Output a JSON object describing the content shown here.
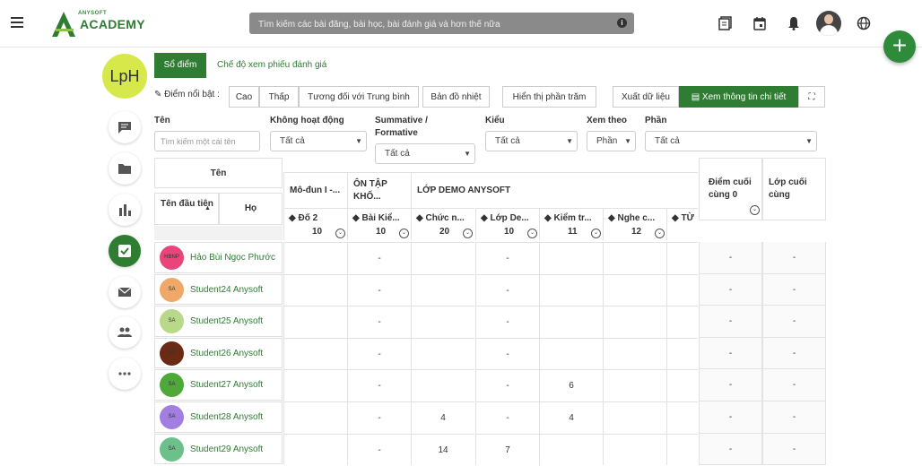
{
  "topbar": {
    "logo_small": "ANYSOFT",
    "logo_main": "ACADEMY",
    "search_placeholder": "Tìm kiếm các bài đăng, bài học, bài đánh giá và hơn thế nữa"
  },
  "course": {
    "avatar_text": "LpH"
  },
  "tabs": [
    {
      "label": "Sổ điểm",
      "active": true
    },
    {
      "label": "Chế độ xem phiếu đánh giá",
      "active": false
    }
  ],
  "toolbar": {
    "highlight_label": "Điểm nổi bật :",
    "highlight_buttons": [
      "Cao",
      "Thấp",
      "Tương đối với Trung bình"
    ],
    "heatmap": "Bản đồ nhiệt",
    "show_percent": "Hiển thị phần trăm",
    "export": "Xuất dữ liệu",
    "detail": "Xem thông tin chi tiết"
  },
  "filters": {
    "name_label": "Tên",
    "name_placeholder": "Tìm kiếm một cái tên",
    "inactive_label": "Không hoạt động",
    "inactive_value": "Tất cả",
    "summative_label": "Summative / Formative",
    "summative_value": "Tất cả",
    "type_label": "Kiểu",
    "type_value": "Tất cả",
    "viewby_label": "Xem theo",
    "viewby_value": "Phần",
    "section_label": "Phần",
    "section_value": "Tất cả"
  },
  "table": {
    "name_header": "Tên",
    "firstname_header": "Tên đầu tiên",
    "lastname_header": "Họ",
    "groups": [
      "Mô-đun I -...",
      "ÔN TẬP KHỐ...",
      "LỚP DEMO ANYSOFT"
    ],
    "final_score_header": "Điểm cuối cùng 0",
    "final_class_header": "Lớp cuối cùng",
    "columns": [
      {
        "name": "Đố 2",
        "points": "10"
      },
      {
        "name": "Bài Kiể...",
        "points": "10"
      },
      {
        "name": "Chức n...",
        "points": "20"
      },
      {
        "name": "Lớp De...",
        "points": "10"
      },
      {
        "name": "Kiểm tr...",
        "points": "11"
      },
      {
        "name": "Nghe c...",
        "points": "12"
      },
      {
        "name": "TỪ",
        "points": ""
      }
    ],
    "students": [
      {
        "initials": "HBNP",
        "name": "Hảo Bùi Ngọc Phước",
        "color": "#e8457a",
        "scores": [
          "",
          "-",
          "",
          "-",
          "",
          "",
          ""
        ],
        "final": "-",
        "final_class": "-"
      },
      {
        "initials": "SA",
        "name": "Student24 Anysoft",
        "color": "#f0a868",
        "scores": [
          "",
          "-",
          "",
          "-",
          "",
          "",
          ""
        ],
        "final": "-",
        "final_class": "-"
      },
      {
        "initials": "SA",
        "name": "Student25 Anysoft",
        "color": "#b8d98a",
        "scores": [
          "",
          "-",
          "",
          "-",
          "",
          "",
          ""
        ],
        "final": "-",
        "final_class": "-"
      },
      {
        "initials": "SA",
        "name": "Student26 Anysoft",
        "color": "#6b2a14",
        "scores": [
          "",
          "-",
          "",
          "-",
          "",
          "",
          ""
        ],
        "final": "-",
        "final_class": "-"
      },
      {
        "initials": "SA",
        "name": "Student27 Anysoft",
        "color": "#4fa83a",
        "scores": [
          "",
          "-",
          "",
          "-",
          "6",
          "",
          ""
        ],
        "final": "-",
        "final_class": "-"
      },
      {
        "initials": "SA",
        "name": "Student28 Anysoft",
        "color": "#a27ee0",
        "scores": [
          "",
          "-",
          "4",
          "-",
          "4",
          "",
          ""
        ],
        "final": "-",
        "final_class": "-"
      },
      {
        "initials": "SA",
        "name": "Student29 Anysoft",
        "color": "#6cc08a",
        "scores": [
          "",
          "-",
          "14",
          "7",
          "",
          "",
          ""
        ],
        "final": "-",
        "final_class": "-"
      }
    ]
  }
}
